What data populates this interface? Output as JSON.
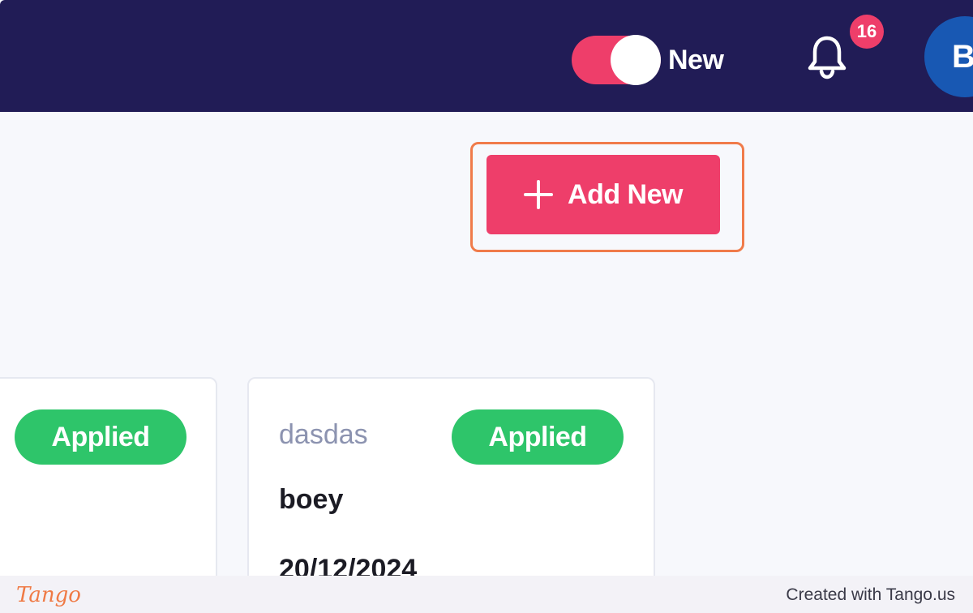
{
  "header": {
    "toggle_label": "New",
    "notification_count": "16",
    "avatar_initial": "B",
    "colors": {
      "background": "#211c56",
      "accent": "#ee3e6a",
      "avatar": "#1858b3"
    }
  },
  "toolbar": {
    "add_new_label": "Add New",
    "add_icon": "plus-icon"
  },
  "cards": [
    {
      "status": "Applied"
    },
    {
      "code": "dasdas",
      "status": "Applied",
      "name": "boey",
      "date": "20/12/2024"
    }
  ],
  "footer": {
    "logo": "Tango",
    "credit": "Created with Tango.us"
  },
  "colors": {
    "status_applied": "#2ec56a",
    "highlight": "#f07b4a"
  }
}
